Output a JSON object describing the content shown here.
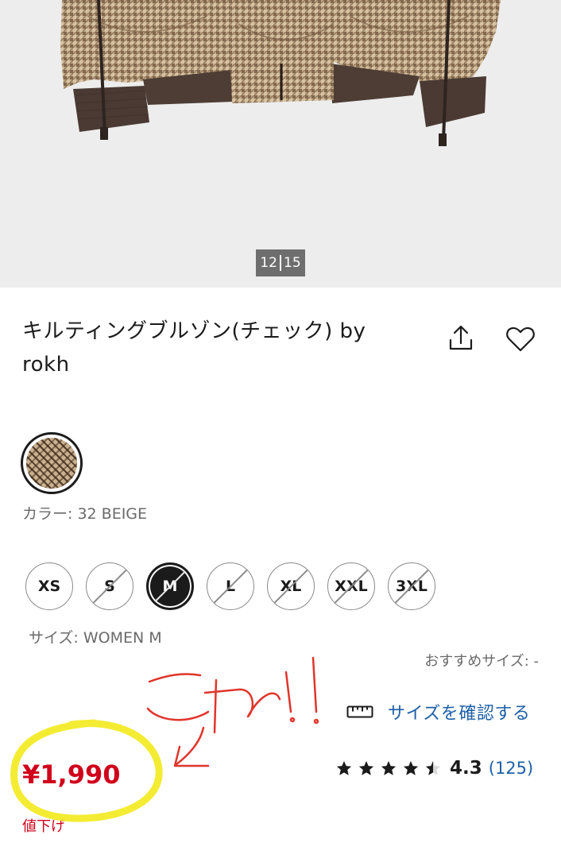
{
  "gallery": {
    "current": "12",
    "total": "15"
  },
  "product": {
    "title": "キルティングブルゾン(チェック) by rokh",
    "color_label": "カラー: 32 BEIGE",
    "size_label": "サイズ: WOMEN M",
    "recommended_size": "おすすめサイズ: -",
    "size_check_label": "サイズを確認する",
    "price": "¥1,990",
    "price_badge": "値下げ",
    "rating": {
      "value": "4.3",
      "count": "(125)",
      "stars": 4.3
    }
  },
  "sizes": [
    {
      "label": "XS",
      "available": true,
      "selected": false
    },
    {
      "label": "S",
      "available": false,
      "selected": false
    },
    {
      "label": "M",
      "available": false,
      "selected": true
    },
    {
      "label": "L",
      "available": false,
      "selected": false
    },
    {
      "label": "XL",
      "available": false,
      "selected": false
    },
    {
      "label": "XXL",
      "available": false,
      "selected": false
    },
    {
      "label": "3XL",
      "available": false,
      "selected": false
    }
  ],
  "annotation": {
    "handwritten_text": "これ!!",
    "marker_color": "#f2ea1c",
    "ink_color": "#e0352b"
  },
  "colors": {
    "price_red": "#d0021b",
    "link_blue": "#1e60a8",
    "image_bg": "#ededed"
  },
  "icons": [
    "share-icon",
    "heart-icon",
    "ruler-icon",
    "star-icon"
  ]
}
